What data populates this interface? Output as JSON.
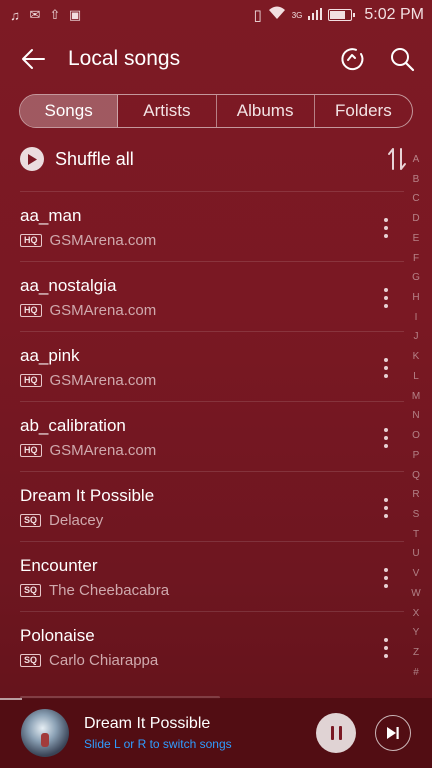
{
  "status_bar": {
    "time": "5:02 PM",
    "network": "3G",
    "battery_level": 0.75,
    "left_icons": [
      "music-note-icon",
      "mail-icon",
      "upload-icon",
      "store-icon"
    ]
  },
  "header": {
    "title": "Local songs"
  },
  "tabs": [
    {
      "label": "Songs",
      "active": true
    },
    {
      "label": "Artists",
      "active": false
    },
    {
      "label": "Albums",
      "active": false
    },
    {
      "label": "Folders",
      "active": false
    }
  ],
  "shuffle": {
    "label": "Shuffle all"
  },
  "songs": [
    {
      "title": "aa_man",
      "badge": "HQ",
      "artist": "GSMArena.com"
    },
    {
      "title": "aa_nostalgia",
      "badge": "HQ",
      "artist": "GSMArena.com"
    },
    {
      "title": "aa_pink",
      "badge": "HQ",
      "artist": "GSMArena.com"
    },
    {
      "title": "ab_calibration",
      "badge": "HQ",
      "artist": "GSMArena.com"
    },
    {
      "title": "Dream It Possible",
      "badge": "SQ",
      "artist": "Delacey"
    },
    {
      "title": "Encounter",
      "badge": "SQ",
      "artist": "The Cheebacabra"
    },
    {
      "title": "Polonaise",
      "badge": "SQ",
      "artist": "Carlo Chiarappa"
    }
  ],
  "alphabet": [
    "A",
    "B",
    "C",
    "D",
    "E",
    "F",
    "G",
    "H",
    "I",
    "J",
    "K",
    "L",
    "M",
    "N",
    "O",
    "P",
    "Q",
    "R",
    "S",
    "T",
    "U",
    "V",
    "W",
    "X",
    "Y",
    "Z",
    "#"
  ],
  "now_playing": {
    "title": "Dream It Possible",
    "hint": "Slide L or R to switch songs",
    "progress": 0.05
  },
  "colors": {
    "background": "#7a1823",
    "hint_text": "#2f9cff"
  }
}
